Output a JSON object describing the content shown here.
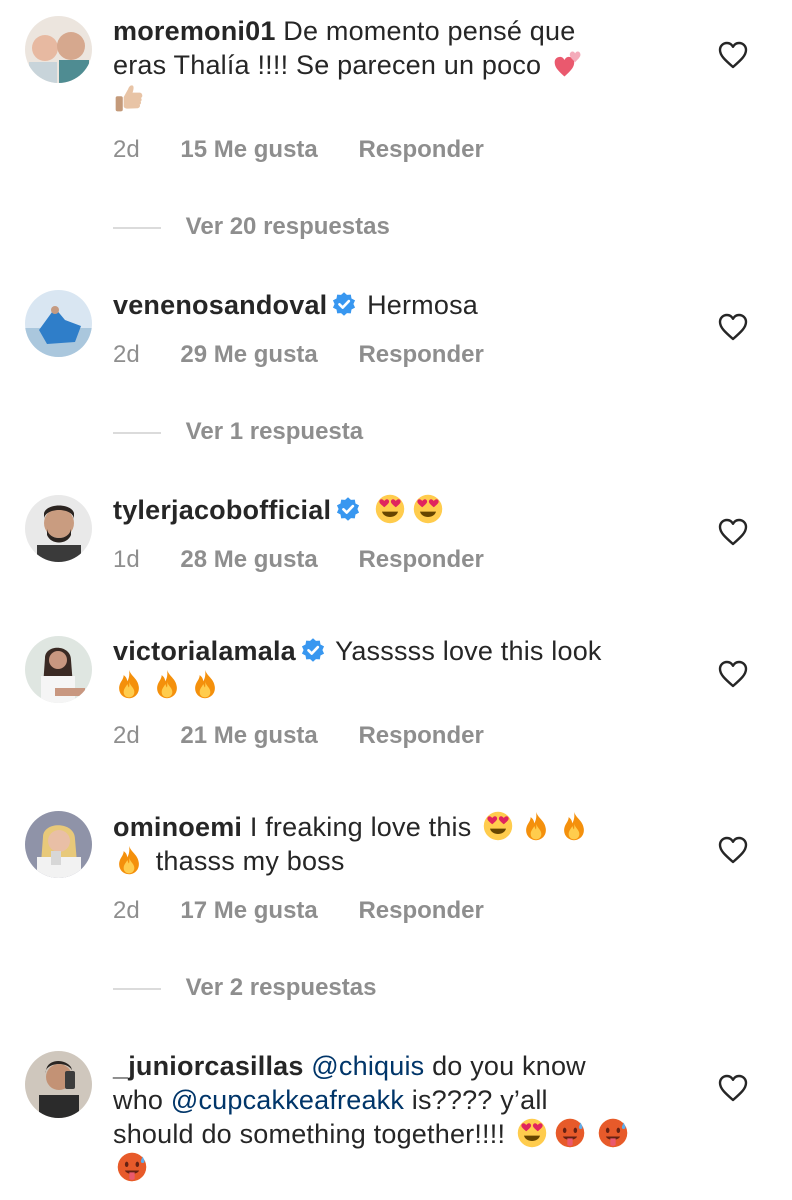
{
  "comments": [
    {
      "username": "moremoni01",
      "verified": false,
      "text": "De momento pensé que eras Thalía !!!! Se parecen un poco",
      "time": "2d",
      "likes": "15 Me gusta",
      "reply_label": "Responder",
      "view_replies": "Ver 20 respuestas"
    },
    {
      "username": "venenosandoval",
      "verified": true,
      "text": "Hermosa",
      "time": "2d",
      "likes": "29 Me gusta",
      "reply_label": "Responder",
      "view_replies": "Ver 1 respuesta"
    },
    {
      "username": "tylerjacobofficial",
      "verified": true,
      "text": "",
      "time": "1d",
      "likes": "28 Me gusta",
      "reply_label": "Responder"
    },
    {
      "username": "victorialamala",
      "verified": true,
      "text": "Yasssss love this look",
      "time": "2d",
      "likes": "21 Me gusta",
      "reply_label": "Responder"
    },
    {
      "username": "ominoemi",
      "verified": false,
      "text_a": "I freaking love this",
      "text_b": "thasss my boss",
      "time": "2d",
      "likes": "17 Me gusta",
      "reply_label": "Responder",
      "view_replies": "Ver 2 respuestas"
    },
    {
      "username": "_juniorcasillas",
      "verified": false,
      "mention_1": "@chiquis",
      "text_a": "do you know who",
      "mention_2": "@cupcakkeafreakk",
      "text_b": "is???? y’all should do something together!!!!"
    }
  ],
  "icons": {
    "like": "heart-outline-icon",
    "verified": "verified-badge-icon",
    "emoji_heart_eyes": "heart-eyes-emoji",
    "emoji_fire": "fire-emoji",
    "emoji_hearts": "two-hearts-emoji",
    "emoji_thumbs": "thumbs-up-emoji",
    "emoji_hot": "hot-face-emoji"
  },
  "colors": {
    "text": "#262626",
    "meta": "#8e8e8e",
    "mention": "#003569",
    "verified": "#3897f0"
  }
}
